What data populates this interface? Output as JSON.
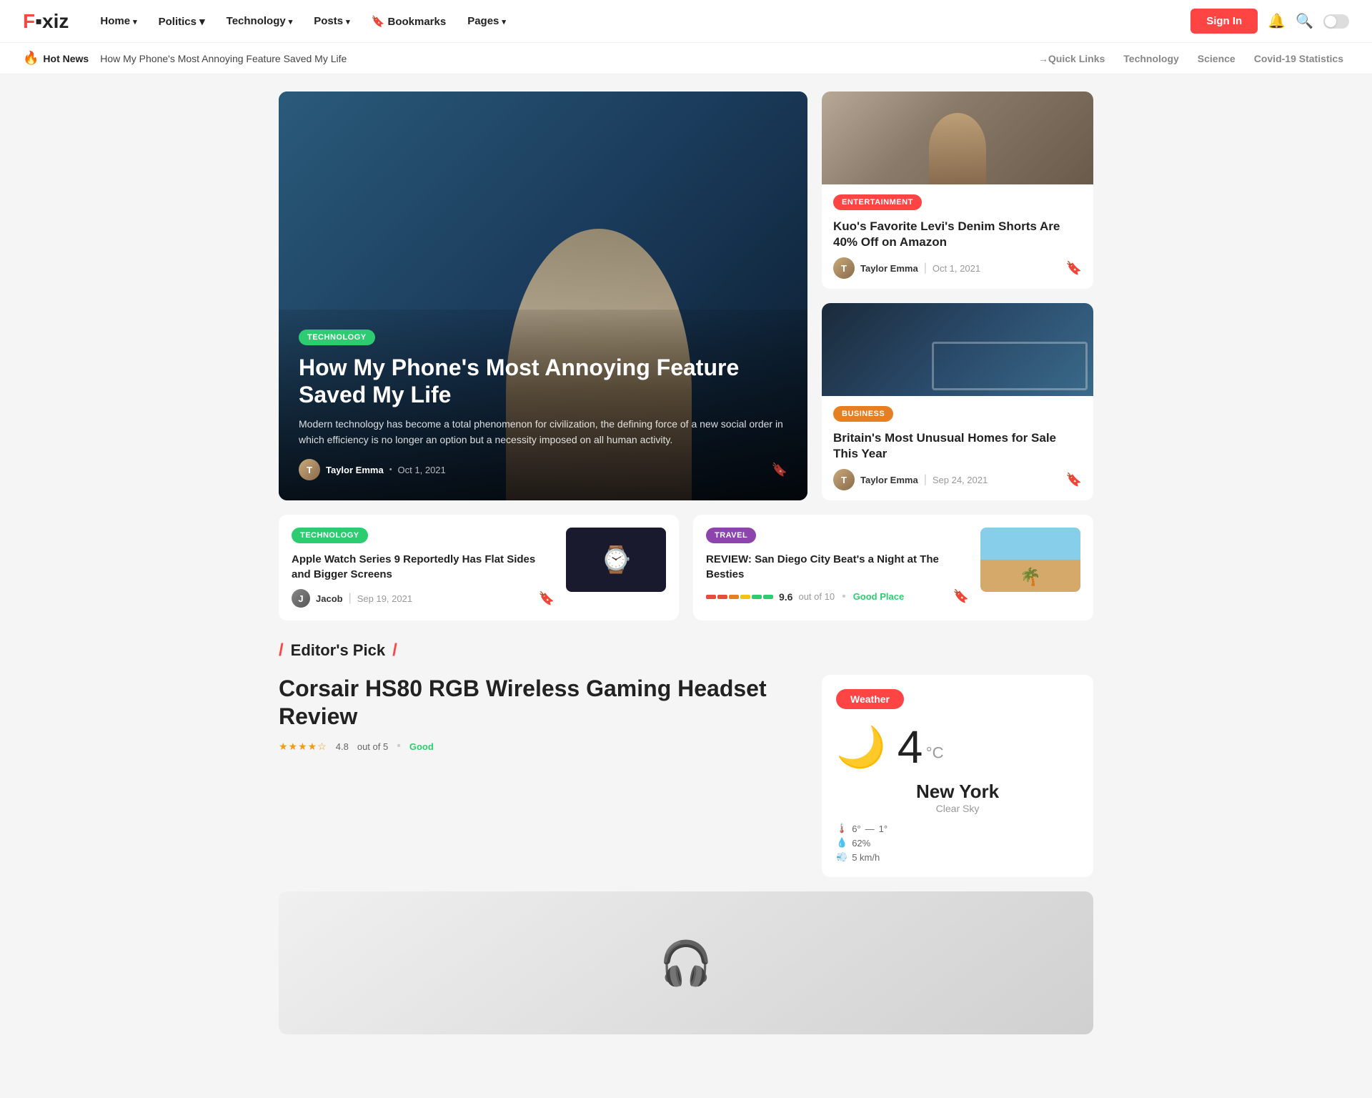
{
  "nav": {
    "logo_text": "F",
    "logo_rest": "xiz",
    "links": [
      {
        "label": "Home",
        "active": true,
        "has_dropdown": true
      },
      {
        "label": "Politics",
        "active": false,
        "has_dropdown": true
      },
      {
        "label": "Technology",
        "active": false,
        "has_dropdown": true
      },
      {
        "label": "Posts",
        "active": false,
        "has_dropdown": true
      },
      {
        "label": "Bookmarks",
        "active": false,
        "has_dropdown": false
      },
      {
        "label": "Pages",
        "active": false,
        "has_dropdown": true
      }
    ],
    "sign_in": "Sign In"
  },
  "ticker": {
    "label": "Hot News",
    "text": "How My Phone's Most Annoying Feature Saved My Life",
    "quick_links_label": "Quick Links",
    "quick_links": [
      "Technology",
      "Science",
      "Covid-19 Statistics"
    ]
  },
  "featured": {
    "tag": "TECHNOLOGY",
    "title": "How My Phone's Most Annoying Feature Saved My Life",
    "description": "Modern technology has become a total phenomenon for civilization, the defining force of a new social order in which efficiency is no longer an option but a necessity imposed on all human activity.",
    "author": "Taylor Emma",
    "date": "Oct 1, 2021"
  },
  "side_articles": [
    {
      "tag": "ENTERTAINMENT",
      "title": "Kuo's Favorite Levi's Denim Shorts Are 40% Off on Amazon",
      "author": "Taylor Emma",
      "date": "Oct 1, 2021"
    },
    {
      "tag": "BUSINESS",
      "title": "Britain's Most Unusual Homes for Sale This Year",
      "author": "Taylor Emma",
      "date": "Sep 24, 2021"
    }
  ],
  "small_articles": [
    {
      "tag": "TECHNOLOGY",
      "title": "Apple Watch Series 9 Reportedly Has Flat Sides and Bigger Screens",
      "author": "Jacob",
      "date": "Sep 19, 2021"
    },
    {
      "tag": "TRAVEL",
      "title": "REVIEW: San Diego City Beat's a Night at The Besties",
      "score": "9.6",
      "score_total": "out of 10",
      "verdict": "Good Place"
    }
  ],
  "editors_pick": {
    "section_title": "Editor's Pick",
    "article": {
      "title": "Corsair HS80 RGB Wireless Gaming Headset Review",
      "rating_value": "4.8",
      "rating_label": "out of 5",
      "verdict": "Good",
      "stars": 4
    }
  },
  "weather": {
    "badge": "Weather",
    "city": "New York",
    "condition": "Clear Sky",
    "temp": "4",
    "unit": "°C",
    "high": "6°",
    "low": "1°",
    "humidity": "62%",
    "wind": "5 km/h"
  }
}
